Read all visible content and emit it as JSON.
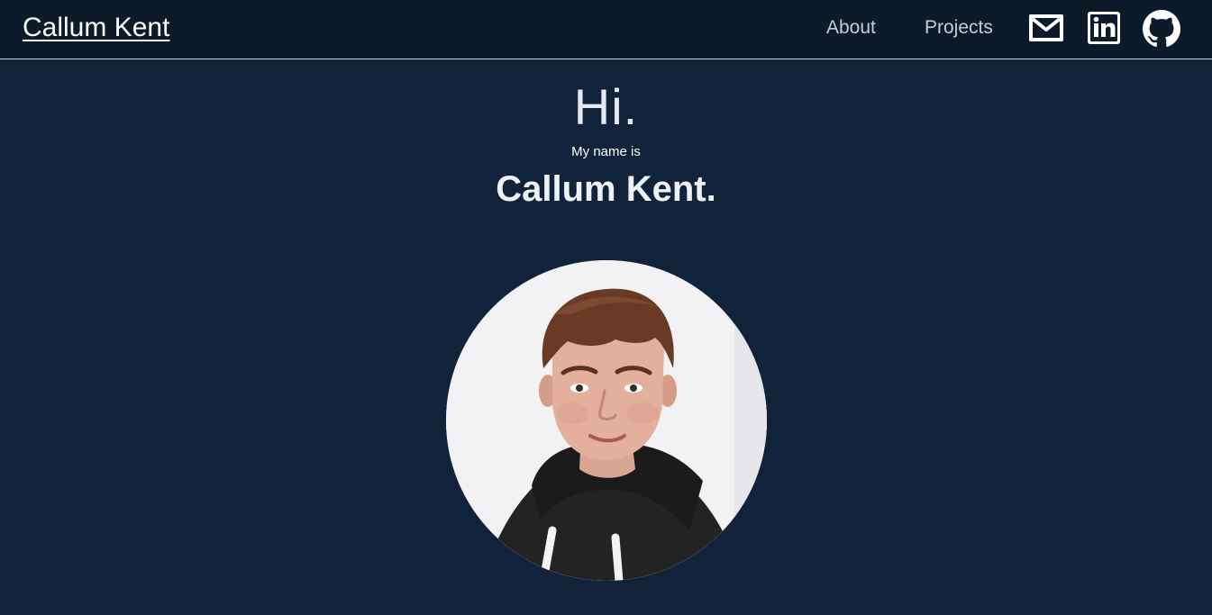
{
  "navbar": {
    "brand": "Callum Kent",
    "links": [
      {
        "label": "About"
      },
      {
        "label": "Projects"
      }
    ],
    "icons": [
      {
        "name": "mail-icon"
      },
      {
        "name": "linkedin-icon"
      },
      {
        "name": "github-icon"
      }
    ]
  },
  "hero": {
    "greeting": "Hi.",
    "intro": "My name is",
    "name": "Callum Kent.",
    "avatar_alt": "profile photo"
  },
  "colors": {
    "background": "#10233a",
    "navbar": "#0c1a2a",
    "text": "#ffffff",
    "nav_link": "#c8ccd2"
  }
}
